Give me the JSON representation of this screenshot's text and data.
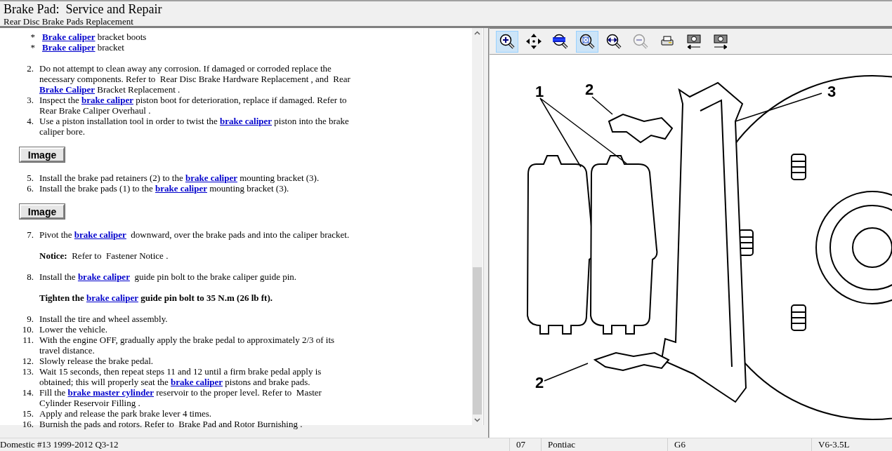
{
  "header": {
    "title": "Brake Pad:  Service and Repair",
    "subtitle": "Rear Disc Brake Pads Replacement"
  },
  "content": [
    [
      {
        "kind": "bullet",
        "marker": "*",
        "parts": [
          {
            "kind": "link",
            "text": "Brake caliper"
          },
          {
            "kind": "plain",
            "text": " bracket boots"
          }
        ]
      },
      {
        "kind": "bullet",
        "marker": "*",
        "parts": [
          {
            "kind": "link",
            "text": "Brake caliper"
          },
          {
            "kind": "plain",
            "text": " bracket"
          }
        ]
      }
    ],
    [
      {
        "kind": "step",
        "number": "2.",
        "parts": [
          {
            "kind": "plain",
            "text": "Do not attempt to clean away any corrosion. If damaged or corroded replace the necessary components. Refer to  Rear Disc Brake Hardware Replacement , and  Rear "
          },
          {
            "kind": "link",
            "text": "Brake Caliper"
          },
          {
            "kind": "plain",
            "text": " Bracket Replacement ."
          }
        ]
      },
      {
        "kind": "step",
        "number": "3.",
        "parts": [
          {
            "kind": "plain",
            "text": "Inspect the "
          },
          {
            "kind": "link",
            "text": "brake caliper"
          },
          {
            "kind": "plain",
            "text": " piston boot for deterioration, replace if damaged. Refer to Rear Brake Caliper Overhaul ."
          }
        ]
      },
      {
        "kind": "step",
        "number": "4.",
        "parts": [
          {
            "kind": "plain",
            "text": "Use a piston installation tool in order to twist the "
          },
          {
            "kind": "link",
            "text": "brake caliper"
          },
          {
            "kind": "plain",
            "text": " piston into the brake caliper bore."
          }
        ]
      }
    ],
    [
      {
        "kind": "button",
        "label": "Image"
      }
    ],
    [
      {
        "kind": "step",
        "number": "5.",
        "parts": [
          {
            "kind": "plain",
            "text": "Install the brake pad retainers (2) to the "
          },
          {
            "kind": "link",
            "text": "brake caliper"
          },
          {
            "kind": "plain",
            "text": " mounting bracket (3)."
          }
        ]
      },
      {
        "kind": "step",
        "number": "6.",
        "parts": [
          {
            "kind": "plain",
            "text": "Install the brake pads (1) to the "
          },
          {
            "kind": "link",
            "text": "brake caliper"
          },
          {
            "kind": "plain",
            "text": " mounting bracket (3)."
          }
        ]
      }
    ],
    [
      {
        "kind": "button",
        "label": "Image"
      }
    ],
    [
      {
        "kind": "step",
        "number": "7.",
        "parts": [
          {
            "kind": "plain",
            "text": "Pivot the "
          },
          {
            "kind": "link",
            "text": "brake caliper"
          },
          {
            "kind": "plain",
            "text": "  downward, over the brake pads and into the caliper bracket."
          }
        ]
      }
    ],
    [
      {
        "kind": "note",
        "parts": [
          {
            "kind": "bold",
            "text": "Notice:"
          },
          {
            "kind": "plain",
            "text": "  Refer to  Fastener Notice ."
          }
        ]
      }
    ],
    [
      {
        "kind": "step",
        "number": "8.",
        "parts": [
          {
            "kind": "plain",
            "text": "Install the "
          },
          {
            "kind": "link",
            "text": "brake caliper"
          },
          {
            "kind": "plain",
            "text": "  guide pin bolt to the brake caliper guide pin."
          }
        ]
      }
    ],
    [
      {
        "kind": "note",
        "parts": [
          {
            "kind": "bold",
            "text": "Tighten the "
          },
          {
            "kind": "link",
            "text": "brake caliper"
          },
          {
            "kind": "bold",
            "text": " guide pin bolt to 35 N.m (26 lb ft)."
          }
        ]
      }
    ],
    [
      {
        "kind": "step",
        "number": "9.",
        "parts": [
          {
            "kind": "plain",
            "text": "Install the tire and wheel assembly."
          }
        ]
      },
      {
        "kind": "step",
        "number": "10.",
        "parts": [
          {
            "kind": "plain",
            "text": "Lower the vehicle."
          }
        ]
      },
      {
        "kind": "step",
        "number": "11.",
        "parts": [
          {
            "kind": "plain",
            "text": "With the engine OFF, gradually apply the brake pedal to approximately 2/3 of its travel distance."
          }
        ]
      },
      {
        "kind": "step",
        "number": "12.",
        "parts": [
          {
            "kind": "plain",
            "text": "Slowly release the brake pedal."
          }
        ]
      },
      {
        "kind": "step",
        "number": "13.",
        "parts": [
          {
            "kind": "plain",
            "text": "Wait 15 seconds, then repeat steps 11 and 12 until a firm brake pedal apply is obtained; this will properly seat the "
          },
          {
            "kind": "link",
            "text": "brake caliper"
          },
          {
            "kind": "plain",
            "text": " pistons and brake pads."
          }
        ]
      },
      {
        "kind": "step",
        "number": "14.",
        "parts": [
          {
            "kind": "plain",
            "text": "Fill the "
          },
          {
            "kind": "link",
            "text": "brake master cylinder"
          },
          {
            "kind": "plain",
            "text": " reservoir to the proper level. Refer to  Master Cylinder Reservoir Filling ."
          }
        ]
      },
      {
        "kind": "step",
        "number": "15.",
        "parts": [
          {
            "kind": "plain",
            "text": "Apply and release the park brake lever 4 times."
          }
        ]
      },
      {
        "kind": "step",
        "number": "16.",
        "parts": [
          {
            "kind": "plain",
            "text": "Burnish the pads and rotors. Refer to  Brake Pad and Rotor Burnishing ."
          }
        ]
      }
    ]
  ],
  "toolbar": [
    {
      "kind": "zoom-in",
      "selected": true,
      "disabled": false
    },
    {
      "kind": "pan",
      "selected": false,
      "disabled": false
    },
    {
      "kind": "zoom-100",
      "selected": false,
      "disabled": false
    },
    {
      "kind": "zoom-fit",
      "selected": true,
      "disabled": false
    },
    {
      "kind": "zoom-width",
      "selected": false,
      "disabled": false
    },
    {
      "kind": "zoom-out",
      "selected": false,
      "disabled": true
    },
    {
      "kind": "print",
      "selected": false,
      "disabled": false
    },
    {
      "kind": "prev-image",
      "selected": false,
      "disabled": false
    },
    {
      "kind": "next-image",
      "selected": false,
      "disabled": false
    }
  ],
  "diagram": {
    "callouts": [
      {
        "label": "1"
      },
      {
        "label": "2"
      },
      {
        "label": "3"
      },
      {
        "label": "2"
      }
    ]
  },
  "status_bar": [
    "Domestic #13 1999-2012 Q3-12",
    "07",
    "Pontiac",
    "G6",
    "V6-3.5L"
  ]
}
